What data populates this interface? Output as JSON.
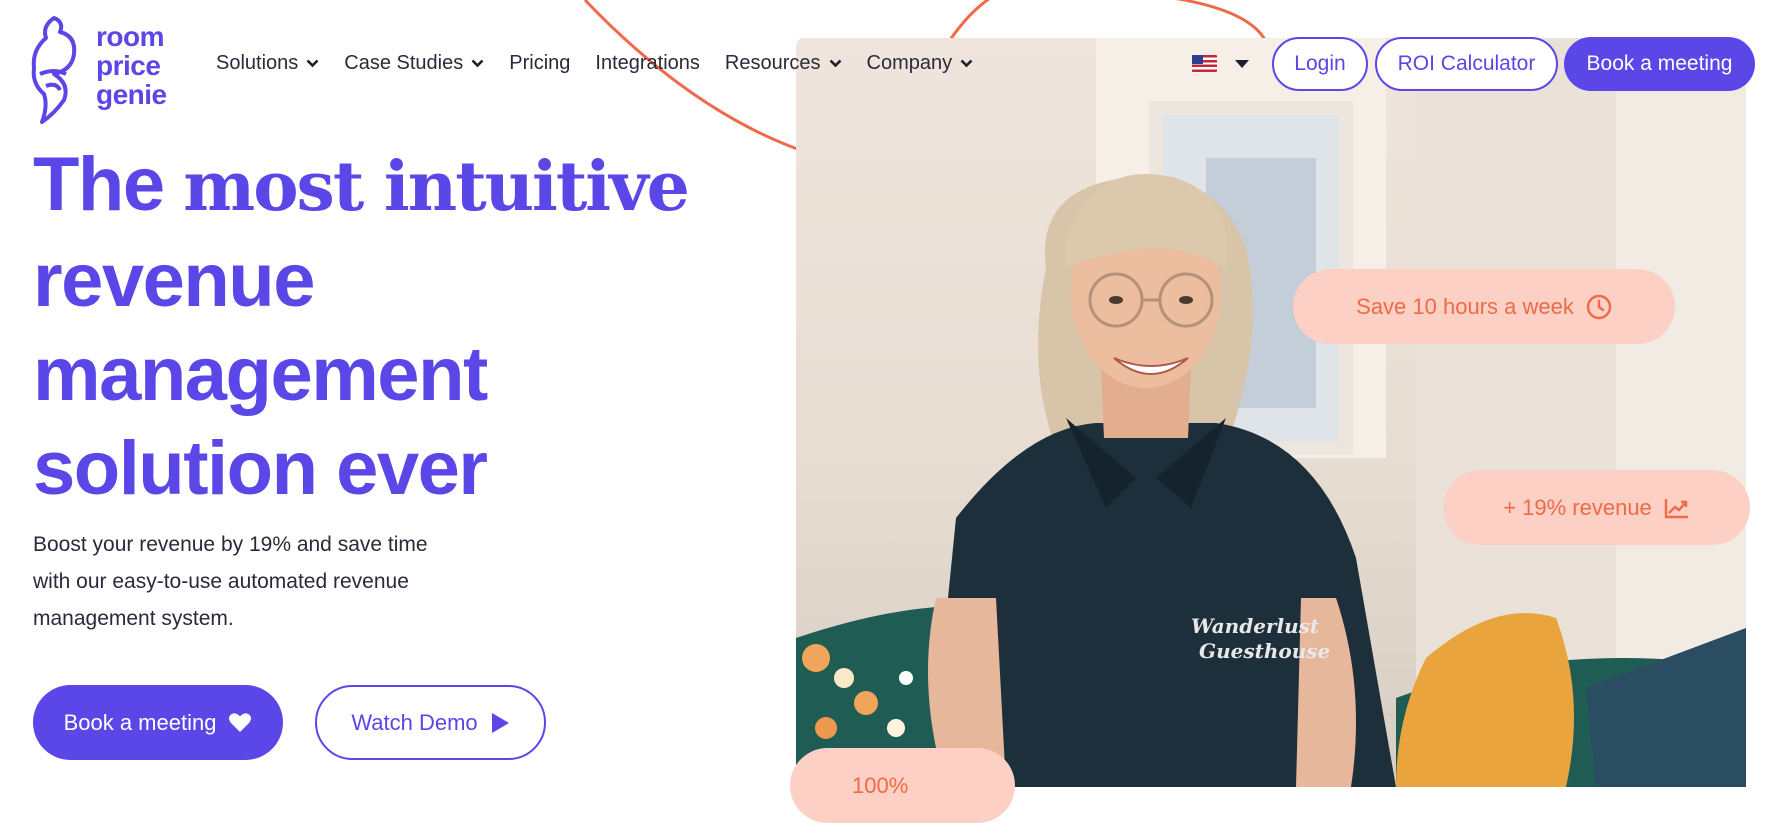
{
  "brand": {
    "logo_lines": [
      "room",
      "price",
      "genie"
    ],
    "logo_icon": "genie-lamp-icon",
    "primary_color": "#5b46e8",
    "accent_color": "#ef6a47",
    "pill_color": "#fcd0c4"
  },
  "nav": {
    "items": [
      {
        "label": "Solutions",
        "has_dropdown": true
      },
      {
        "label": "Case Studies",
        "has_dropdown": true
      },
      {
        "label": "Pricing",
        "has_dropdown": false
      },
      {
        "label": "Integrations",
        "has_dropdown": false
      },
      {
        "label": "Resources",
        "has_dropdown": true
      },
      {
        "label": "Company",
        "has_dropdown": true
      }
    ],
    "language_icon": "us-flag-icon",
    "login_label": "Login",
    "roi_label": "ROI Calculator",
    "book_label": "Book a meeting"
  },
  "hero": {
    "title_part1": "The",
    "title_part2": "most intuitive",
    "title_line2": "revenue",
    "title_line3": "management",
    "title_line4": "solution ever",
    "subtitle": "Boost your revenue by 19% and save time with our easy-to-use automated revenue management system.",
    "cta_book_label": "Book a meeting",
    "cta_book_icon": "heart-icon",
    "cta_demo_label": "Watch Demo",
    "cta_demo_icon": "play-icon"
  },
  "photo": {
    "shirt_text_line1": "Wanderlust",
    "shirt_text_line2": "Guesthouse"
  },
  "badges": {
    "save_label": "Save 10 hours a week",
    "save_icon": "clock-icon",
    "revenue_label": "+ 19% revenue",
    "revenue_icon": "trend-chart-icon",
    "partial_label": "100%"
  }
}
